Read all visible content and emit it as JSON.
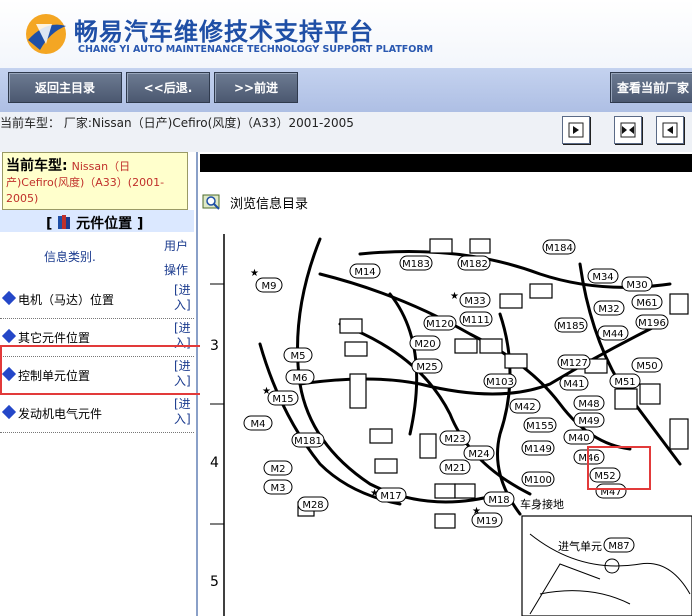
{
  "header": {
    "brand_cn": "畅易汽车维修技术支持平台",
    "brand_en": "CHANG YI AUTO MAINTENANCE TECHNOLOGY SUPPORT PLATFORM"
  },
  "toolbar": {
    "back_home": "返回主目录",
    "prev": "<<后退.",
    "next": ">>前进",
    "view_current": "查看当前厂家"
  },
  "info_line": "当前车型： 厂家:Nissan（日产)Cefiro(风度)（A33）2001-2005",
  "model_box": {
    "label": "当前车型:",
    "value": "Nissan（日产)Cefiro(风度)（A33）(2001-2005)"
  },
  "section": {
    "title": "元件位置 ]",
    "title_prefix": "["
  },
  "columns": {
    "category": "信息类别.",
    "action_line1": "用户",
    "action_line2": "操作"
  },
  "rows": [
    {
      "label": "电机（马达）位置",
      "action_l1": "[进",
      "action_l2": "入]"
    },
    {
      "label": "其它元件位置",
      "action_l1": "[进",
      "action_l2": "入]"
    },
    {
      "label": "控制单元位置",
      "action_l1": "[进",
      "action_l2": "入]"
    },
    {
      "label": "发动机电气元件",
      "action_l1": "[进",
      "action_l2": "入]"
    }
  ],
  "browse": {
    "label": "浏览信息目录"
  },
  "diagram": {
    "ruler": [
      "3",
      "4",
      "5"
    ],
    "labels": [
      "M184",
      "M14",
      "M183",
      "M182",
      "M9",
      "M33",
      "M34",
      "M30",
      "M61",
      "M120",
      "M111",
      "M185",
      "M32",
      "M44",
      "M196",
      "M20",
      "M5",
      "M25",
      "M127",
      "M50",
      "M6",
      "M103",
      "M41",
      "M51",
      "M15",
      "M4",
      "M42",
      "M48",
      "M155",
      "M49",
      "M181",
      "M23",
      "M149",
      "M40",
      "M2",
      "M24",
      "M46",
      "M21",
      "M52",
      "M3",
      "M100",
      "M47",
      "M28",
      "M17",
      "M18",
      "M19",
      "M87"
    ],
    "text_body_ground": "车身接地",
    "text_intake_unit": "进气单元"
  },
  "colors": {
    "brand_blue": "#1f4fa6",
    "toolbar_bg": "#b7c7e8",
    "button_bg": "#5a667c",
    "highlight": "#e23a3a",
    "model_value": "#c0302b"
  }
}
